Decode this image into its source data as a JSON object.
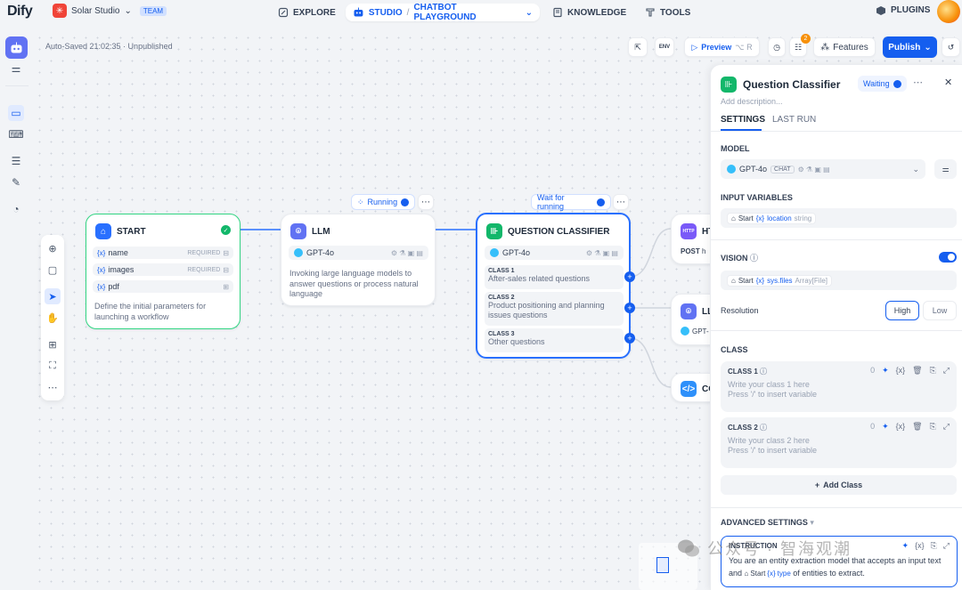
{
  "app": {
    "logo": "Dify"
  },
  "workspace": {
    "name": "Solar Studio",
    "tag": "TEAM"
  },
  "nav": {
    "explore": "EXPLORE",
    "studio": "STUDIO",
    "app_name": "CHATBOT PLAYGROUND",
    "knowledge": "KNOWLEDGE",
    "tools": "TOOLS",
    "plugins": "PLUGINS"
  },
  "toolbar": {
    "autosave": "Auto-Saved 21:02:35 · Unpublished",
    "preview": "Preview",
    "preview_shortcut": "⌥ R",
    "features": "Features",
    "publish": "Publish",
    "checklist_badge": "2",
    "env_label": "ENV"
  },
  "nodes": {
    "start": {
      "title": "START",
      "vars": [
        {
          "name": "name",
          "req": "REQUIRED"
        },
        {
          "name": "images",
          "req": "REQUIRED"
        },
        {
          "name": "pdf",
          "req": ""
        }
      ],
      "desc": "Define the initial parameters for launching a workflow"
    },
    "llm": {
      "title": "LLM",
      "status": "Running",
      "model": "GPT-4o",
      "desc": "Invoking large language models to answer questions or process natural language"
    },
    "qc": {
      "title": "QUESTION CLASSIFIER",
      "status": "Wait for running",
      "model": "GPT-4o",
      "classes": [
        {
          "label": "CLASS 1",
          "desc": "After-sales related questions"
        },
        {
          "label": "CLASS 2",
          "desc": "Product positioning and planning issues questions"
        },
        {
          "label": "CLASS 3",
          "desc": "Other questions"
        }
      ]
    },
    "http": {
      "title": "HT",
      "method": "POST",
      "url": "h"
    },
    "llm2": {
      "title": "LL",
      "model": "GPT-"
    },
    "code": {
      "title": "CO"
    }
  },
  "panel": {
    "title": "Question Classifier",
    "status": "Waiting",
    "desc_placeholder": "Add description...",
    "tabs": [
      "SETTINGS",
      "LAST RUN"
    ],
    "model_label": "MODEL",
    "model": "GPT-4o",
    "model_tag": "CHAT",
    "input_label": "INPUT VARIABLES",
    "input_node": "Start",
    "input_var": "location",
    "input_type": "string",
    "vision_label": "VISION",
    "vision_node": "Start",
    "vision_var": "sys.files",
    "vision_type": "Array[File]",
    "resolution_label": "Resolution",
    "res_high": "High",
    "res_low": "Low",
    "class_label": "CLASS",
    "classes": [
      {
        "label": "CLASS 1",
        "count": "0",
        "placeholder": "Write your class 1 here",
        "hint": "Press '/' to insert variable"
      },
      {
        "label": "CLASS 2",
        "count": "0",
        "placeholder": "Write your class 2 here",
        "hint": "Press '/' to insert variable"
      }
    ],
    "add_class": "Add Class",
    "advanced_label": "ADVANCED SETTINGS",
    "instruction_label": "INSTRUCTION",
    "instruction_p1": "You are an entity extraction model that accepts an input text and",
    "instruction_node": "Start",
    "instruction_var": "type",
    "instruction_p2": "of entities to extract."
  },
  "watermark": "公众号 · 智海观潮",
  "colors": {
    "accent": "#155eef",
    "start_border": "#32d583",
    "selected_border": "#2970ff"
  }
}
